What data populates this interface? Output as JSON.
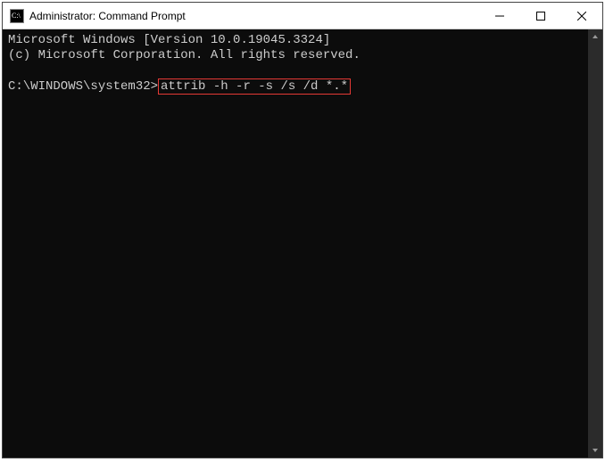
{
  "window": {
    "title": "Administrator: Command Prompt"
  },
  "terminal": {
    "line1": "Microsoft Windows [Version 10.0.19045.3324]",
    "line2": "(c) Microsoft Corporation. All rights reserved.",
    "prompt": "C:\\WINDOWS\\system32>",
    "command": "attrib -h -r -s /s /d *.*"
  }
}
